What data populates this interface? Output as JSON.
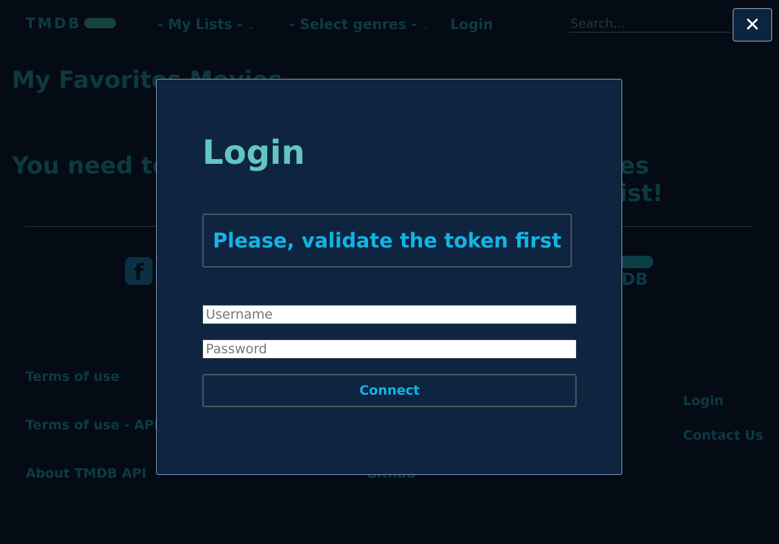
{
  "header": {
    "logo_text": "TMDB",
    "nav_lists": "- My Lists -",
    "nav_genres": "- Select genres -",
    "nav_login": "Login",
    "search_placeholder": "Search..."
  },
  "close_label": "✕",
  "page": {
    "title": "My Favorites Movies",
    "notice_start": "You need to",
    "notice_end": "ies list!"
  },
  "footer": {
    "logo_text": "DB",
    "col1": [
      "Terms of use",
      "Terms of use - API",
      "About TMDB API"
    ],
    "col2_last": "Github",
    "col3": [
      "Login",
      "Contact Us"
    ]
  },
  "modal": {
    "title": "Login",
    "alert": "Please, validate the token first",
    "username_placeholder": "Username",
    "password_placeholder": "Password",
    "connect_label": "Connect"
  },
  "colors": {
    "accent": "#12b4e3",
    "title_gradient": "#62c6c0",
    "modal_bg": "#0e2441",
    "page_bg": "#040b15"
  }
}
